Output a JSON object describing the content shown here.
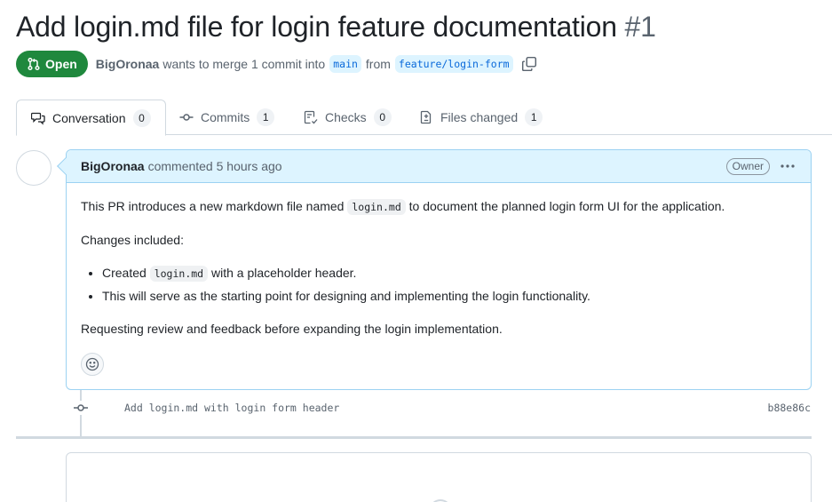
{
  "pr": {
    "title": "Add login.md file for login feature documentation",
    "number": "#1",
    "state": "Open",
    "author": "BigOronaa",
    "merge_text": "wants to merge 1 commit into",
    "base_branch": "main",
    "from_text": "from",
    "head_branch": "feature/login-form"
  },
  "tabs": [
    {
      "label": "Conversation",
      "count": "0"
    },
    {
      "label": "Commits",
      "count": "1"
    },
    {
      "label": "Checks",
      "count": "0"
    },
    {
      "label": "Files changed",
      "count": "1"
    }
  ],
  "comment": {
    "author": "BigOronaa",
    "action": "commented",
    "time": "5 hours ago",
    "badge": "Owner",
    "body": {
      "p1_before": "This PR introduces a new markdown file named",
      "p1_code": "login.md",
      "p1_after": "to document the planned login form UI for the application.",
      "p2": "Changes included:",
      "li1_before": "Created",
      "li1_code": "login.md",
      "li1_after": "with a placeholder header.",
      "li2": "This will serve as the starting point for designing and implementing the login functionality.",
      "p3": "Requesting review and feedback before expanding the login implementation."
    }
  },
  "commit": {
    "message": "Add login.md with login form header",
    "sha": "b88e86c"
  },
  "colors": {
    "open_green": "#1f883d",
    "link_blue": "#0969da",
    "header_blue": "#ddf4ff"
  }
}
